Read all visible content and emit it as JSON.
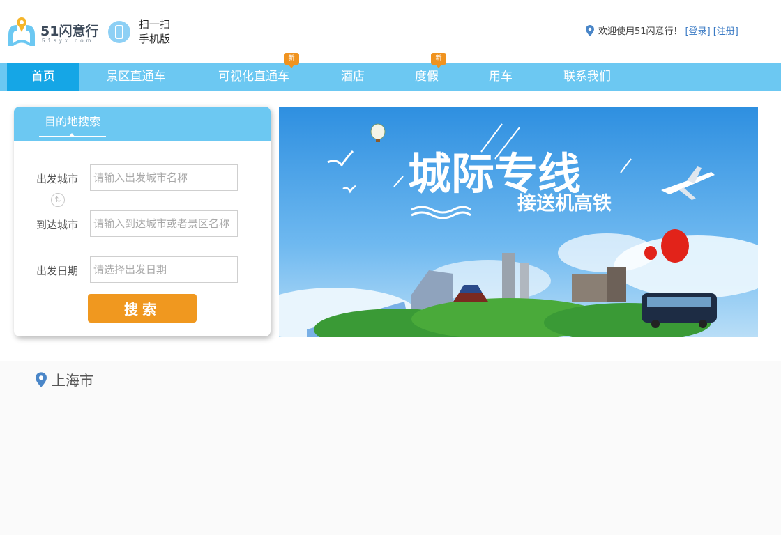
{
  "header": {
    "logo_text": "51闪意行",
    "logo_sub": "51syx.com",
    "scan_line1": "扫一扫",
    "scan_line2": "手机版",
    "welcome": "欢迎使用51闪意行！",
    "login": "[登录]",
    "register": "[注册]"
  },
  "nav": {
    "items": [
      {
        "label": "首页",
        "active": true
      },
      {
        "label": "景区直通车"
      },
      {
        "label": "可视化直通车",
        "badge": "新"
      },
      {
        "label": "酒店"
      },
      {
        "label": "度假",
        "badge": "新"
      },
      {
        "label": "用车"
      },
      {
        "label": "联系我们"
      }
    ]
  },
  "search": {
    "tab": "目的地搜索",
    "depart_label": "出发城市",
    "depart_placeholder": "请输入出发城市名称",
    "arrive_label": "到达城市",
    "arrive_placeholder": "请输入到达城市或者景区名称",
    "date_label": "出发日期",
    "date_placeholder": "请选择出发日期",
    "button": "搜索"
  },
  "banner": {
    "title": "城际专线",
    "subtitle": "接送机高铁"
  },
  "location": {
    "city": "上海市"
  },
  "colors": {
    "nav_bg": "#6cc8f2",
    "nav_active": "#15a6e6",
    "accent_orange": "#f0981f",
    "link_blue": "#3a7ac4"
  }
}
